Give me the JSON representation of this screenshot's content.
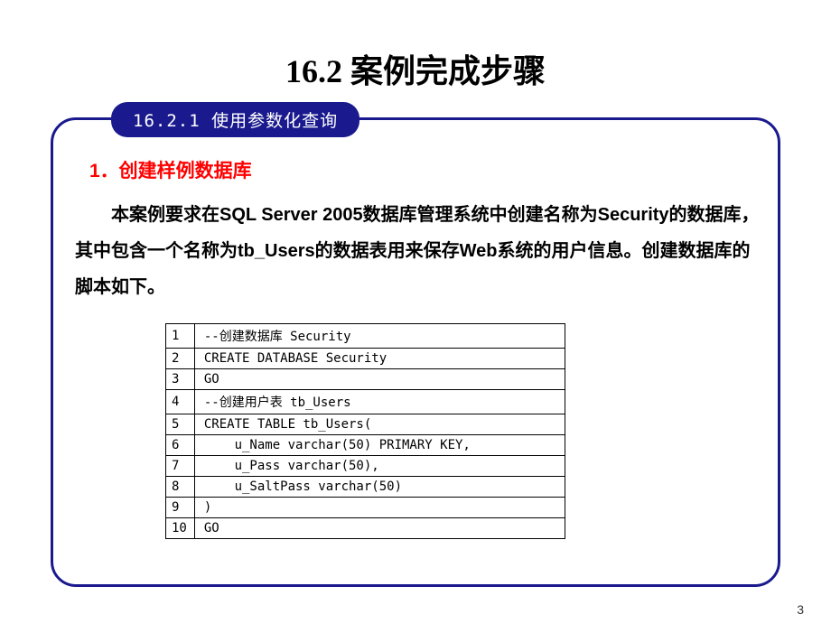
{
  "title": "16.2 案例完成步骤",
  "subsection": "16.2.1 使用参数化查询",
  "subtitle": "1．创建样例数据库",
  "body": "本案例要求在SQL Server 2005数据库管理系统中创建名称为Security的数据库，其中包含一个名称为tb_Users的数据表用来保存Web系统的用户信息。创建数据库的脚本如下。",
  "code_lines": [
    {
      "n": "1",
      "c": "--创建数据库 Security"
    },
    {
      "n": "2",
      "c": "CREATE DATABASE Security"
    },
    {
      "n": "3",
      "c": "GO"
    },
    {
      "n": "4",
      "c": "--创建用户表 tb_Users"
    },
    {
      "n": "5",
      "c": "CREATE TABLE tb_Users("
    },
    {
      "n": "6",
      "c": "    u_Name varchar(50) PRIMARY KEY,"
    },
    {
      "n": "7",
      "c": "    u_Pass varchar(50),"
    },
    {
      "n": "8",
      "c": "    u_SaltPass varchar(50)"
    },
    {
      "n": "9",
      "c": ")"
    },
    {
      "n": "10",
      "c": "GO"
    }
  ],
  "page_number": "3"
}
